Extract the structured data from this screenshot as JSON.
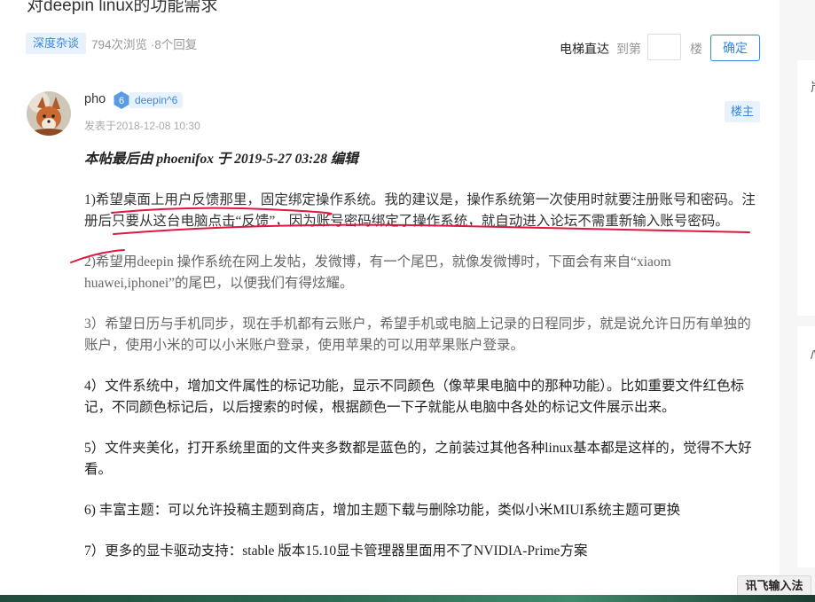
{
  "post": {
    "title": "对deepin linux的功能需求",
    "category": "深度杂谈",
    "stats": "794次浏览 ·8个回复"
  },
  "elevator": {
    "label": "电梯直达",
    "to": "到第",
    "floor_unit": "楼",
    "floor_value": "",
    "go": "确定"
  },
  "author": {
    "name": "pho",
    "level_num": "6",
    "level_name": "deepin^6",
    "posted_at": "发表于2018-12-08 10:30",
    "floor": "楼主"
  },
  "content": {
    "edit_note": "本帖最后由 phoenifox 于 2019-5-27 03:28 编辑",
    "items": [
      "1)希望桌面上用户反馈那里，固定绑定操作系统。我的建议是，操作系统第一次使用时就要注册账号和密码。注册后只要从这台电脑点击“反馈”，因为账号密码绑定了操作系统，就自动进入论坛不需重新输入账号密码。",
      "2)希望用deepin 操作系统在网上发帖，发微博，有一个尾巴，就像发微博时，下面会有来自“xiaom huawei,iphonei”的尾巴，以便我们有得炫耀。",
      "3）希望日历与手机同步，现在手机都有云账户，希望手机或电脑上记录的日程同步，就是说允许日历有单独的账户，使用小米的可以小米账户登录，使用苹果的可以用苹果账户登录。",
      "4）文件系统中，增加文件属性的标记功能，显示不同颜色（像苹果电脑中的那种功能）。比如重要文件红色标记，不同颜色标记后，以后搜索的时候，根据颜色一下子就能从电脑中各处的标记文件展示出来。",
      "5）文件夹美化，打开系统里面的文件夹多数都是蓝色的，之前装过其他各种linux基本都是这样的，觉得不大好看。",
      "6) 丰富主题：可以允许投稿主题到商店，增加主题下载与删除功能，类似小米MIUI系统主题可更换",
      "7）更多的显卡驱动支持：stable 版本15.10显卡管理器里面用不了NVIDIA-Prime方案"
    ]
  },
  "sidebar": {
    "glyph_1": "屵",
    "glyph_2": "/\\"
  },
  "ime": {
    "label": "讯飞输入法"
  },
  "colors": {
    "accent": "#3b86e0",
    "tag_bg": "#e8f2fd",
    "annotation": "#e0173f"
  }
}
